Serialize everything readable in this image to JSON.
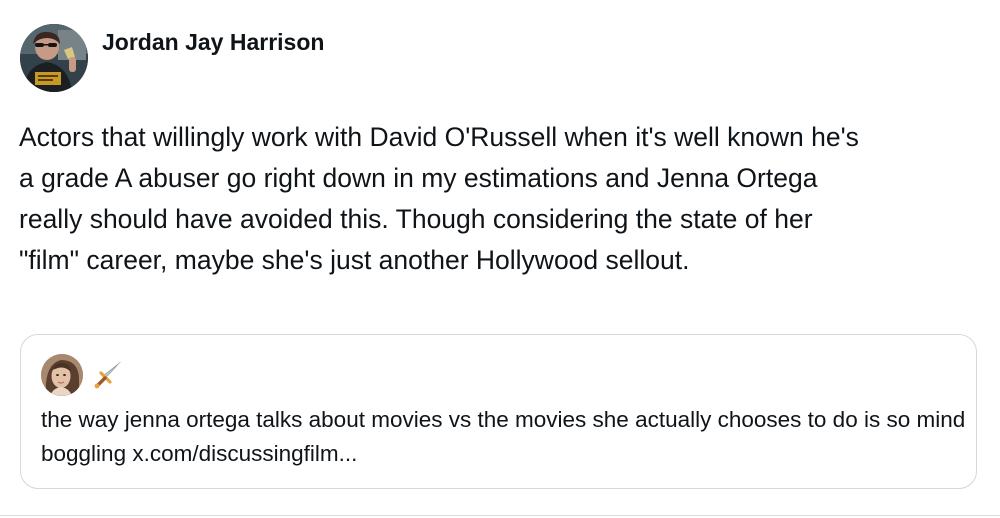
{
  "post": {
    "author_name": "Jordan Jay Harrison",
    "text": "Actors that willingly work with David O'Russell when it's  well known he's\na grade A abuser go right down in my estimations and Jenna Ortega\nreally should have avoided this. Though considering the state of her\n\"film\" career, maybe she's just another Hollywood sellout."
  },
  "quoted_post": {
    "emoji_icon": "dagger-icon",
    "text": "the way jenna ortega talks about movies vs the movies she actually chooses to do is so mind boggling ",
    "link_text": "x.com/discussingfilm..."
  },
  "colors": {
    "text": "#0f1419",
    "card_border": "#cfd9de",
    "background": "#ffffff"
  }
}
